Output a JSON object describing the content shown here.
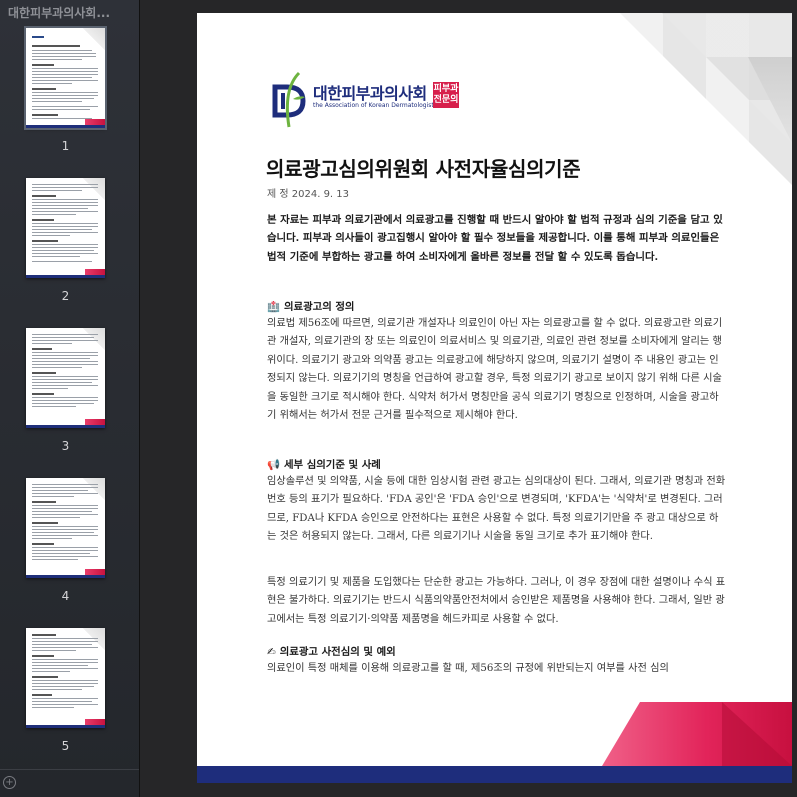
{
  "sidebar": {
    "title": "대한피부과의사회...",
    "pages": [
      {
        "number": "1"
      },
      {
        "number": "2"
      },
      {
        "number": "3"
      },
      {
        "number": "4"
      },
      {
        "number": "5"
      }
    ],
    "add_label": "+"
  },
  "document": {
    "logo": {
      "korean_name": "대한피부과의사회",
      "english_name": "the Association of Korean Dermatologists",
      "badge_line1": "피부과",
      "badge_line2": "전문의"
    },
    "title": "의료광고심의위원회 사전자율심의기준",
    "revision": "제 정 2024. 9. 13",
    "intro": "본 자료는 피부과 의료기관에서 의료광고를 진행할 때 반드시 알아야 할 법적 규정과 심의 기준을 담고 있습니다. 피부과 의사들이 광고집행시 알아야 할 필수 정보들을 제공합니다. 이를 통해 피부과 의료인들은 법적 기준에 부합하는 광고를 하여 소비자에게 올바른 정보를 전달 할 수 있도록 돕습니다.",
    "sections": [
      {
        "icon": "🏥",
        "heading": "의료광고의 정의",
        "paragraphs": [
          "의료법 제56조에 따르면, 의료기관 개설자나 의료인이 아닌 자는 의료광고를 할 수 없다. 의료광고란 의료기관 개설자, 의료기관의 장 또는 의료인이 의료서비스 및 의료기관, 의료인 관련 정보를 소비자에게 알리는 행위이다. 의료기기 광고와 의약품 광고는 의료광고에 해당하지 않으며, 의료기기 설명이 주 내용인 광고는 인정되지 않는다. 의료기기의 명칭을 언급하여 광고할 경우, 특정 의료기기 광고로 보이지 않기 위해 다른 시술을 동일한 크기로 적시해야 한다. 식약처 허가서 명칭만을 공식 의료기기 명칭으로 인정하며, 시술을 광고하기 위해서는 허가서 전문 근거를 필수적으로 제시해야 한다."
        ]
      },
      {
        "icon": "📢",
        "heading": "세부 심의기준 및 사례",
        "paragraphs": [
          "임상솔루션 및 의약품, 시술 등에 대한 임상시험 관련 광고는 심의대상이 된다. 그래서, 의료기관 명칭과 전화번호 등의 표기가 필요하다. 'FDA 공인'은 'FDA 승인'으로 변경되며, 'KFDA'는 '식약처'로 변경된다. 그러므로, FDA나 KFDA 승인으로 안전하다는 표현은 사용할 수 없다. 특정 의료기기만을 주 광고 대상으로 하는 것은 허용되지 않는다. 그래서, 다른 의료기기나 시술을 동일 크기로 추가 표기해야 한다.",
          "특정 의료기기 및 제품을 도입했다는 단순한 광고는 가능하다. 그러나, 이 경우 장점에 대한 설명이나 수식 표현은 불가하다. 의료기기는 반드시 식품의약품안전처에서 승인받은 제품명을 사용해야 한다. 그래서, 일반 광고에서는 특정 의료기기·의약품 제품명을 헤드카피로 사용할 수 없다."
        ]
      },
      {
        "icon": "✍",
        "heading": "의료광고 사전심의 및 예외",
        "paragraphs": [
          "의료인이 특정 매체를 이용해 의료광고를 할 때, 제56조의 규정에 위반되는지 여부를 사전 심의"
        ]
      }
    ]
  },
  "colors": {
    "sidebar_bg": "#2a2d33",
    "main_bg": "#262628",
    "navy": "#1e2d7c",
    "pink": "#e2245a",
    "badge_red": "#d71f4b",
    "logo_green": "#6db33f"
  }
}
